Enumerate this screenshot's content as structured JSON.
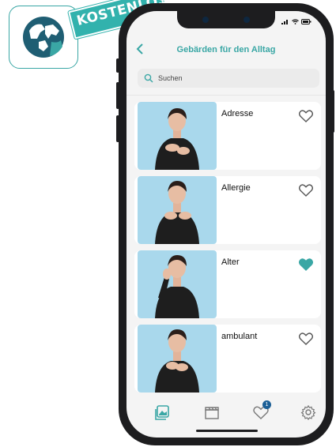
{
  "badge": {
    "ribbon_text": "KOSTENLOS"
  },
  "app": {
    "title": "Gebärden für den Alltag",
    "back_icon": "chevron-left-icon",
    "search": {
      "placeholder": "Suchen",
      "value": ""
    }
  },
  "items": [
    {
      "word": "Adresse",
      "favorite": false
    },
    {
      "word": "Allergie",
      "favorite": false
    },
    {
      "word": "Alter",
      "favorite": true
    },
    {
      "word": "ambulant",
      "favorite": false
    }
  ],
  "tabbar": {
    "tabs": [
      {
        "name": "gallery-icon",
        "active": true
      },
      {
        "name": "clapperboard-icon",
        "active": false
      },
      {
        "name": "heart-icon",
        "active": false,
        "badge": "1"
      },
      {
        "name": "gear-icon",
        "active": false
      }
    ]
  },
  "colors": {
    "accent": "#3aa7a5",
    "badge": "#1c5f96",
    "thumb_bg": "#a9d8ec"
  }
}
